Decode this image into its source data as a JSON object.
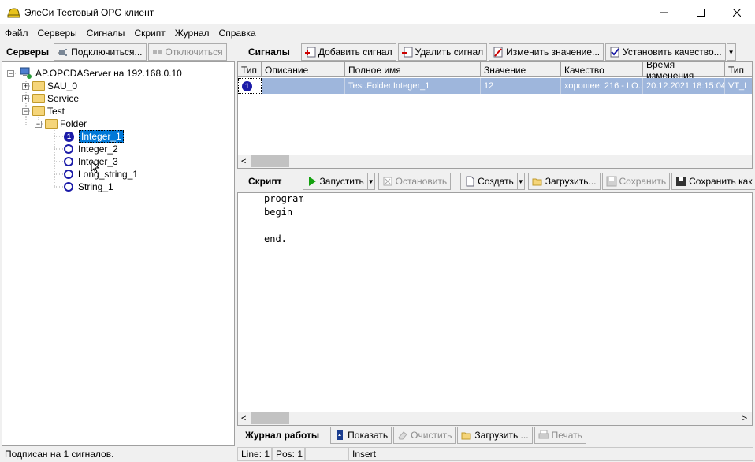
{
  "window": {
    "title": "ЭлеСи Тестовый OPC клиент",
    "minimize_icon": "minimize-icon",
    "maximize_icon": "maximize-icon",
    "close_icon": "close-icon"
  },
  "menu": [
    "Файл",
    "Серверы",
    "Сигналы",
    "Скрипт",
    "Журнал",
    "Справка"
  ],
  "servers": {
    "label": "Серверы",
    "connect": "Подключиться...",
    "disconnect": "Отключиться",
    "tree": {
      "root": "AP.OPCDAServer на 192.168.0.10",
      "sau": "SAU_0",
      "service": "Service",
      "test": "Test",
      "folder": "Folder",
      "signals": [
        "Integer_1",
        "Integer_2",
        "Integer_3",
        "Long_string_1",
        "String_1"
      ],
      "selected_badge": "1"
    }
  },
  "signals": {
    "label": "Сигналы",
    "add": "Добавить сигнал",
    "remove": "Удалить сигнал",
    "change": "Изменить значение...",
    "quality": "Установить качество...",
    "columns": [
      "Тип",
      "Описание",
      "Полное имя",
      "Значение",
      "Качество",
      "Время изменения",
      "Тип"
    ],
    "rows": [
      {
        "type_badge": "1",
        "description": "",
        "full_name": "Test.Folder.Integer_1",
        "value": "12",
        "quality": "хорошее: 216 - LO...",
        "time": "20.12.2021 18:15:04",
        "vtype": "VT_I"
      }
    ]
  },
  "script": {
    "label": "Скрипт",
    "run": "Запустить",
    "stop": "Остановить",
    "create": "Создать",
    "load": "Загрузить...",
    "save": "Сохранить",
    "save_as": "Сохранить как ...",
    "code": [
      "program",
      "begin",
      "",
      "end."
    ]
  },
  "log": {
    "label": "Журнал работы",
    "show": "Показать",
    "clear": "Очистить",
    "load": "Загрузить ...",
    "print": "Печать"
  },
  "status": {
    "subscribed": "Подписан на 1 сигналов.",
    "line": "Line: 1",
    "pos": "Pos: 1",
    "mode": "Insert"
  }
}
